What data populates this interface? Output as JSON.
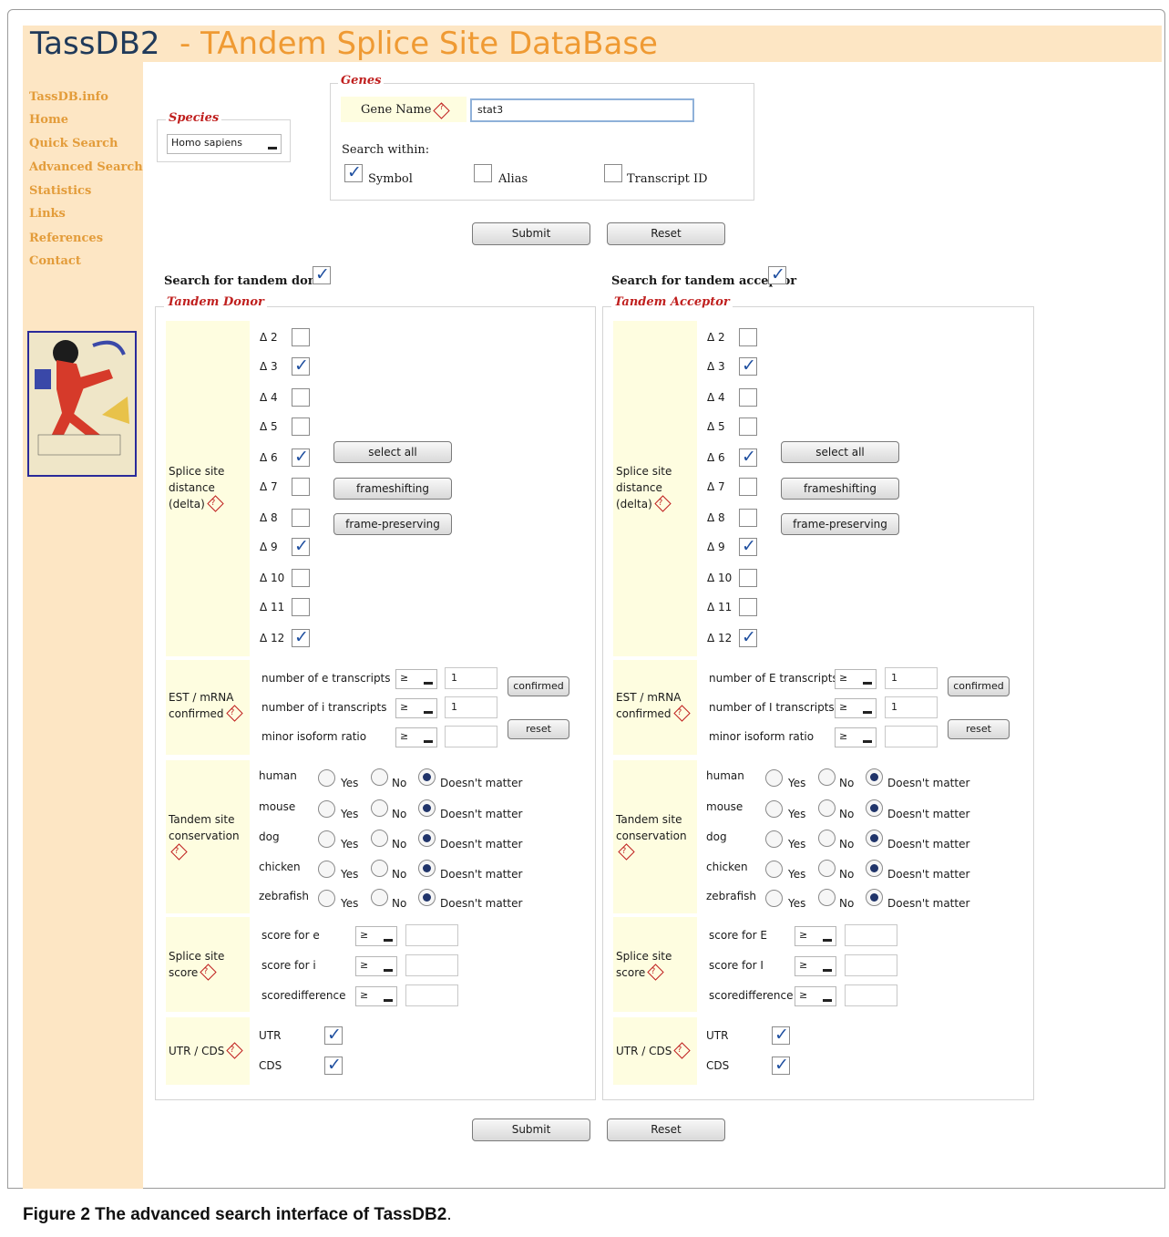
{
  "header": {
    "brand": "TassDB2",
    "separator": " - ",
    "subtitle": "TAndem Splice Site DataBase"
  },
  "sidebar": {
    "links": [
      "TassDB.info",
      "Home",
      "Quick Search",
      "Advanced Search",
      "Statistics",
      "Links",
      "References",
      "Contact"
    ]
  },
  "species": {
    "legend": "Species",
    "value": "Homo sapiens"
  },
  "genes": {
    "legend": "Genes",
    "gene_name_label": "Gene Name",
    "gene_name_value": "stat3",
    "search_within_label": "Search within:",
    "symbol_label": "Symbol",
    "symbol_checked": true,
    "alias_label": "Alias",
    "alias_checked": false,
    "transcript_label": "Transcript ID",
    "transcript_checked": false
  },
  "buttons": {
    "submit": "Submit",
    "reset": "Reset",
    "select_all": "select all",
    "frameshifting": "frameshifting",
    "frame_preserving": "frame-preserving",
    "confirmed": "confirmed",
    "reset_small": "reset"
  },
  "donor": {
    "search_label": "Search for tandem donor",
    "search_checked": true,
    "legend": "Tandem Donor",
    "splice_label": "Splice site distance (delta)",
    "deltas": [
      {
        "label": "Δ 2",
        "checked": false
      },
      {
        "label": "Δ 3",
        "checked": true
      },
      {
        "label": "Δ 4",
        "checked": false
      },
      {
        "label": "Δ 5",
        "checked": false
      },
      {
        "label": "Δ 6",
        "checked": true
      },
      {
        "label": "Δ 7",
        "checked": false
      },
      {
        "label": "Δ 8",
        "checked": false
      },
      {
        "label": "Δ 9",
        "checked": true
      },
      {
        "label": "Δ 10",
        "checked": false
      },
      {
        "label": "Δ 11",
        "checked": false
      },
      {
        "label": "Δ 12",
        "checked": true
      }
    ],
    "est_label": "EST / mRNA confirmed",
    "est_rows": [
      {
        "label": "number of e transcripts",
        "op": "≥",
        "value": "1"
      },
      {
        "label": "number of i transcripts",
        "op": "≥",
        "value": "1"
      },
      {
        "label": "minor isoform ratio",
        "op": "≥",
        "value": ""
      }
    ],
    "cons_label": "Tandem site conservation",
    "species": [
      "human",
      "mouse",
      "dog",
      "chicken",
      "zebrafish"
    ],
    "score_label": "Splice site score",
    "score_rows": [
      {
        "label": "score for e",
        "op": "≥",
        "value": ""
      },
      {
        "label": "score for i",
        "op": "≥",
        "value": ""
      },
      {
        "label": "scoredifference",
        "op": "≥",
        "value": ""
      }
    ],
    "utr_label": "UTR / CDS",
    "utr_rows": [
      {
        "label": "UTR",
        "checked": true
      },
      {
        "label": "CDS",
        "checked": true
      }
    ]
  },
  "acceptor": {
    "search_label": "Search for tandem acceptor",
    "search_checked": true,
    "legend": "Tandem Acceptor",
    "splice_label": "Splice site distance (delta)",
    "deltas": [
      {
        "label": "Δ 2",
        "checked": false
      },
      {
        "label": "Δ 3",
        "checked": true
      },
      {
        "label": "Δ 4",
        "checked": false
      },
      {
        "label": "Δ 5",
        "checked": false
      },
      {
        "label": "Δ 6",
        "checked": true
      },
      {
        "label": "Δ 7",
        "checked": false
      },
      {
        "label": "Δ 8",
        "checked": false
      },
      {
        "label": "Δ 9",
        "checked": true
      },
      {
        "label": "Δ 10",
        "checked": false
      },
      {
        "label": "Δ 11",
        "checked": false
      },
      {
        "label": "Δ 12",
        "checked": true
      }
    ],
    "est_label": "EST / mRNA confirmed",
    "est_rows": [
      {
        "label": "number of E transcripts",
        "op": "≥",
        "value": "1"
      },
      {
        "label": "number of I transcripts",
        "op": "≥",
        "value": "1"
      },
      {
        "label": "minor isoform ratio",
        "op": "≥",
        "value": ""
      }
    ],
    "cons_label": "Tandem site conservation",
    "species": [
      "human",
      "mouse",
      "dog",
      "chicken",
      "zebrafish"
    ],
    "score_label": "Splice site score",
    "score_rows": [
      {
        "label": "score for E",
        "op": "≥",
        "value": ""
      },
      {
        "label": "score for I",
        "op": "≥",
        "value": ""
      },
      {
        "label": "scoredifference",
        "op": "≥",
        "value": ""
      }
    ],
    "utr_label": "UTR / CDS",
    "utr_rows": [
      {
        "label": "UTR",
        "checked": true
      },
      {
        "label": "CDS",
        "checked": true
      }
    ]
  },
  "radio": {
    "yes": "Yes",
    "no": "No",
    "doesnt_matter": "Doesn't matter",
    "selected": "doesnt_matter"
  },
  "help_glyph": "?",
  "caption": {
    "bold": "Figure 2 The advanced search interface of TassDB2",
    "rest": "."
  }
}
